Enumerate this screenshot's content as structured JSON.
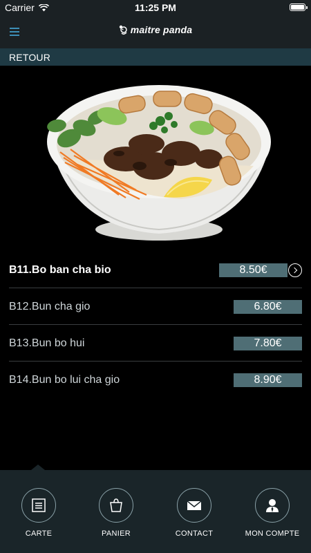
{
  "status_bar": {
    "carrier": "Carrier",
    "time": "11:25 PM",
    "icons": [
      "wifi-icon",
      "battery-icon"
    ]
  },
  "nav_bar": {
    "menu_icon": "hamburger-menu-icon",
    "brand": "maitre panda",
    "brand_icon": "panda-icon",
    "accent_color": "#3d8fb8"
  },
  "back_bar": {
    "label": "RETOUR",
    "color": "#1f3a44"
  },
  "dish_image": {
    "icon": "noodle-bowl-image"
  },
  "menu": {
    "items": [
      {
        "name": "B11.Bo ban cha bio",
        "price": "8.50€",
        "active": true
      },
      {
        "name": "B12.Bun cha gio",
        "price": "6.80€",
        "active": false
      },
      {
        "name": "B13.Bun bo hui",
        "price": "7.80€",
        "active": false
      },
      {
        "name": "B14.Bun bo lui cha gio",
        "price": "8.90€",
        "active": false
      }
    ],
    "price_color": "#4f6e75"
  },
  "tab_bar": {
    "tabs": [
      {
        "label": "CARTE",
        "icon": "list-icon"
      },
      {
        "label": "PANIER",
        "icon": "shopping-bag-icon"
      },
      {
        "label": "CONTACT",
        "icon": "envelope-icon"
      },
      {
        "label": "MON COMPTE",
        "icon": "user-icon"
      }
    ],
    "color": "#1a2529"
  }
}
